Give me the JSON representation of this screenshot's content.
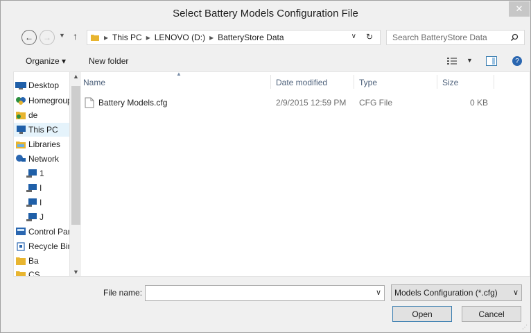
{
  "window": {
    "title": "Select Battery Models Configuration File"
  },
  "address": {
    "crumbs": [
      "This PC",
      "LENOVO (D:)",
      "BatteryStore Data"
    ],
    "separator": "▸"
  },
  "search": {
    "placeholder": "Search BatteryStore Data"
  },
  "toolbar": {
    "organize": "Organize ▾",
    "new_folder": "New folder"
  },
  "nav_items": [
    {
      "label": "Desktop",
      "icon": "desktop-icon"
    },
    {
      "label": "Homegroup",
      "icon": "homegroup-icon"
    },
    {
      "label": "de",
      "icon": "user-folder-icon"
    },
    {
      "label": "This PC",
      "icon": "computer-icon"
    },
    {
      "label": "Libraries",
      "icon": "library-icon"
    },
    {
      "label": "Network",
      "icon": "network-icon"
    },
    {
      "label": "1",
      "icon": "network-computer-icon"
    },
    {
      "label": "I",
      "icon": "network-computer-icon"
    },
    {
      "label": "I",
      "icon": "network-computer-icon"
    },
    {
      "label": "J",
      "icon": "network-computer-icon"
    },
    {
      "label": "Control Panel",
      "icon": "control-panel-icon"
    },
    {
      "label": "Recycle Bin",
      "icon": "recycle-bin-icon"
    },
    {
      "label": "Ba",
      "icon": "folder-icon"
    },
    {
      "label": "CS",
      "icon": "folder-icon"
    }
  ],
  "columns": {
    "name": "Name",
    "date": "Date modified",
    "type": "Type",
    "size": "Size"
  },
  "files": [
    {
      "name": "Battery Models.cfg",
      "date": "2/9/2015 12:59 PM",
      "type": "CFG File",
      "size": "0 KB"
    }
  ],
  "footer": {
    "file_name_label": "File name:",
    "file_name_value": "",
    "filter_value": "Models Configuration (*.cfg)",
    "open_label": "Open",
    "cancel_label": "Cancel"
  },
  "colors": {
    "header_text": "#4c607a",
    "folder": "#e8b530",
    "selection": "#e5f3fb"
  }
}
